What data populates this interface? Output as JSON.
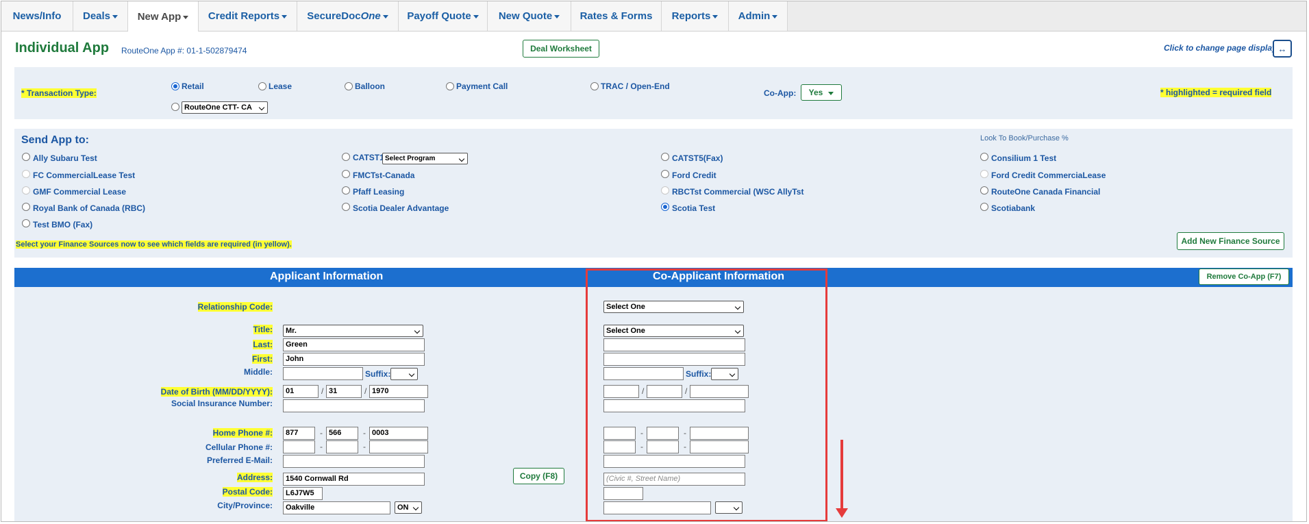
{
  "nav": {
    "tabs": [
      {
        "label": "News/Info",
        "caret": false
      },
      {
        "label": "Deals",
        "caret": true
      },
      {
        "label": "New App",
        "caret": true,
        "active": true
      },
      {
        "label": "Credit Reports",
        "caret": true
      },
      {
        "label_a": "SecureDoc",
        "label_b": "One",
        "caret": true
      },
      {
        "label": "Payoff Quote",
        "caret": true
      },
      {
        "label": "New Quote",
        "caret": true
      },
      {
        "label": "Rates & Forms",
        "caret": false
      },
      {
        "label": "Reports",
        "caret": true
      },
      {
        "label": "Admin",
        "caret": true
      }
    ]
  },
  "header": {
    "title": "Individual App",
    "app_number": "RouteOne App #: 01-1-502879474",
    "deal_worksheet": "Deal Worksheet",
    "change_display": "Click to change page display",
    "toggle_icon": "↔"
  },
  "transaction": {
    "label": "* Transaction Type:",
    "options": [
      "Retail",
      "Lease",
      "Balloon",
      "Payment Call",
      "TRAC / Open-End"
    ],
    "selected": "Retail",
    "routeone_select": "RouteOne CTT- CA",
    "coapp_label": "Co-App:",
    "coapp_value": "Yes",
    "required_note": "* highlighted = required field"
  },
  "send_app": {
    "title": "Send App to:",
    "look_to_book": "Look To Book/Purchase %",
    "sources": [
      {
        "name": "Ally Subaru Test"
      },
      {
        "name": "FC CommercialLease Test"
      },
      {
        "name": "GMF Commercial Lease"
      },
      {
        "name": "Royal Bank of Canada (RBC)"
      },
      {
        "name": "Test BMO (Fax)"
      },
      {
        "name": "CATST1"
      },
      {
        "name": "FMCTst-Canada"
      },
      {
        "name": "Pfaff Leasing"
      },
      {
        "name": "Scotia Dealer Advantage"
      },
      {
        "name": "CATST5(Fax)"
      },
      {
        "name": "Ford Credit"
      },
      {
        "name": "RBCTst Commercial (WSC AllyTst"
      },
      {
        "name": "Scotia Test"
      },
      {
        "name": "Consilium 1 Test"
      },
      {
        "name": "Ford Credit CommerciaLease"
      },
      {
        "name": "RouteOne Canada Financial"
      },
      {
        "name": "Scotiabank"
      }
    ],
    "catst1_program": "Select Program",
    "instructions": "Select your Finance Sources now to see which fields are required (in yellow).",
    "add_finance": "Add New Finance Source"
  },
  "applicant_section": {
    "applicant_title": "Applicant Information",
    "coapplicant_title": "Co-Applicant Information",
    "remove_coapp": "Remove Co-App  (F7)",
    "copy_button": "Copy (F8)"
  },
  "labels": {
    "relationship": "Relationship Code:",
    "title": "Title:",
    "last": "Last:",
    "first": "First:",
    "middle": "Middle:",
    "suffix": "Suffix:",
    "dob": "Date of Birth (MM/DD/YYYY):",
    "sin": "Social Insurance Number:",
    "home_phone": "Home Phone #:",
    "cell_phone": "Cellular Phone #:",
    "email": "Preferred E-Mail:",
    "address": "Address:",
    "postal": "Postal Code:",
    "city": "City/Province:"
  },
  "applicant": {
    "title": "Mr.",
    "last": "Green",
    "first": "John",
    "middle": "",
    "dob_mm": "01",
    "dob_dd": "31",
    "dob_yyyy": "1970",
    "phone_a": "877",
    "phone_b": "566",
    "phone_c": "0003",
    "address": "1540 Cornwall Rd",
    "postal": "L6J7W5",
    "city": "Oakville",
    "province": "ON"
  },
  "coapplicant": {
    "relationship": "Select One",
    "title": "Select One",
    "address_placeholder": "(Civic #, Street Name)"
  },
  "colors": {
    "brand_green": "#1f7a3c",
    "link_blue": "#1c57a3",
    "section_blue": "#1c6fcf",
    "required_yellow": "#ffff33",
    "annotation_red": "#e53b3b"
  }
}
